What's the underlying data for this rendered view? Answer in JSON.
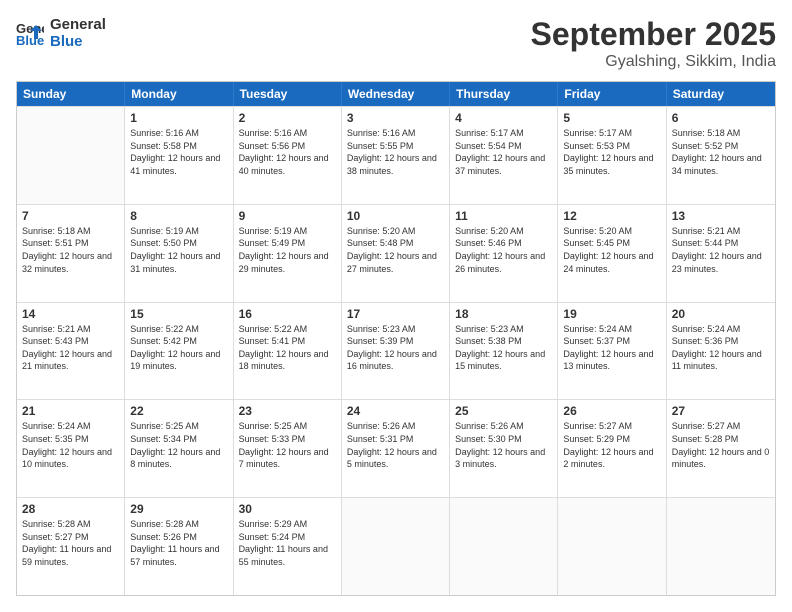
{
  "header": {
    "logo_line1": "General",
    "logo_line2": "Blue",
    "month_title": "September 2025",
    "location": "Gyalshing, Sikkim, India"
  },
  "weekdays": [
    "Sunday",
    "Monday",
    "Tuesday",
    "Wednesday",
    "Thursday",
    "Friday",
    "Saturday"
  ],
  "weeks": [
    [
      {
        "day": "",
        "sunrise": "",
        "sunset": "",
        "daylight": "",
        "empty": true
      },
      {
        "day": "1",
        "sunrise": "Sunrise: 5:16 AM",
        "sunset": "Sunset: 5:58 PM",
        "daylight": "Daylight: 12 hours and 41 minutes."
      },
      {
        "day": "2",
        "sunrise": "Sunrise: 5:16 AM",
        "sunset": "Sunset: 5:56 PM",
        "daylight": "Daylight: 12 hours and 40 minutes."
      },
      {
        "day": "3",
        "sunrise": "Sunrise: 5:16 AM",
        "sunset": "Sunset: 5:55 PM",
        "daylight": "Daylight: 12 hours and 38 minutes."
      },
      {
        "day": "4",
        "sunrise": "Sunrise: 5:17 AM",
        "sunset": "Sunset: 5:54 PM",
        "daylight": "Daylight: 12 hours and 37 minutes."
      },
      {
        "day": "5",
        "sunrise": "Sunrise: 5:17 AM",
        "sunset": "Sunset: 5:53 PM",
        "daylight": "Daylight: 12 hours and 35 minutes."
      },
      {
        "day": "6",
        "sunrise": "Sunrise: 5:18 AM",
        "sunset": "Sunset: 5:52 PM",
        "daylight": "Daylight: 12 hours and 34 minutes."
      }
    ],
    [
      {
        "day": "7",
        "sunrise": "Sunrise: 5:18 AM",
        "sunset": "Sunset: 5:51 PM",
        "daylight": "Daylight: 12 hours and 32 minutes."
      },
      {
        "day": "8",
        "sunrise": "Sunrise: 5:19 AM",
        "sunset": "Sunset: 5:50 PM",
        "daylight": "Daylight: 12 hours and 31 minutes."
      },
      {
        "day": "9",
        "sunrise": "Sunrise: 5:19 AM",
        "sunset": "Sunset: 5:49 PM",
        "daylight": "Daylight: 12 hours and 29 minutes."
      },
      {
        "day": "10",
        "sunrise": "Sunrise: 5:20 AM",
        "sunset": "Sunset: 5:48 PM",
        "daylight": "Daylight: 12 hours and 27 minutes."
      },
      {
        "day": "11",
        "sunrise": "Sunrise: 5:20 AM",
        "sunset": "Sunset: 5:46 PM",
        "daylight": "Daylight: 12 hours and 26 minutes."
      },
      {
        "day": "12",
        "sunrise": "Sunrise: 5:20 AM",
        "sunset": "Sunset: 5:45 PM",
        "daylight": "Daylight: 12 hours and 24 minutes."
      },
      {
        "day": "13",
        "sunrise": "Sunrise: 5:21 AM",
        "sunset": "Sunset: 5:44 PM",
        "daylight": "Daylight: 12 hours and 23 minutes."
      }
    ],
    [
      {
        "day": "14",
        "sunrise": "Sunrise: 5:21 AM",
        "sunset": "Sunset: 5:43 PM",
        "daylight": "Daylight: 12 hours and 21 minutes."
      },
      {
        "day": "15",
        "sunrise": "Sunrise: 5:22 AM",
        "sunset": "Sunset: 5:42 PM",
        "daylight": "Daylight: 12 hours and 19 minutes."
      },
      {
        "day": "16",
        "sunrise": "Sunrise: 5:22 AM",
        "sunset": "Sunset: 5:41 PM",
        "daylight": "Daylight: 12 hours and 18 minutes."
      },
      {
        "day": "17",
        "sunrise": "Sunrise: 5:23 AM",
        "sunset": "Sunset: 5:39 PM",
        "daylight": "Daylight: 12 hours and 16 minutes."
      },
      {
        "day": "18",
        "sunrise": "Sunrise: 5:23 AM",
        "sunset": "Sunset: 5:38 PM",
        "daylight": "Daylight: 12 hours and 15 minutes."
      },
      {
        "day": "19",
        "sunrise": "Sunrise: 5:24 AM",
        "sunset": "Sunset: 5:37 PM",
        "daylight": "Daylight: 12 hours and 13 minutes."
      },
      {
        "day": "20",
        "sunrise": "Sunrise: 5:24 AM",
        "sunset": "Sunset: 5:36 PM",
        "daylight": "Daylight: 12 hours and 11 minutes."
      }
    ],
    [
      {
        "day": "21",
        "sunrise": "Sunrise: 5:24 AM",
        "sunset": "Sunset: 5:35 PM",
        "daylight": "Daylight: 12 hours and 10 minutes."
      },
      {
        "day": "22",
        "sunrise": "Sunrise: 5:25 AM",
        "sunset": "Sunset: 5:34 PM",
        "daylight": "Daylight: 12 hours and 8 minutes."
      },
      {
        "day": "23",
        "sunrise": "Sunrise: 5:25 AM",
        "sunset": "Sunset: 5:33 PM",
        "daylight": "Daylight: 12 hours and 7 minutes."
      },
      {
        "day": "24",
        "sunrise": "Sunrise: 5:26 AM",
        "sunset": "Sunset: 5:31 PM",
        "daylight": "Daylight: 12 hours and 5 minutes."
      },
      {
        "day": "25",
        "sunrise": "Sunrise: 5:26 AM",
        "sunset": "Sunset: 5:30 PM",
        "daylight": "Daylight: 12 hours and 3 minutes."
      },
      {
        "day": "26",
        "sunrise": "Sunrise: 5:27 AM",
        "sunset": "Sunset: 5:29 PM",
        "daylight": "Daylight: 12 hours and 2 minutes."
      },
      {
        "day": "27",
        "sunrise": "Sunrise: 5:27 AM",
        "sunset": "Sunset: 5:28 PM",
        "daylight": "Daylight: 12 hours and 0 minutes."
      }
    ],
    [
      {
        "day": "28",
        "sunrise": "Sunrise: 5:28 AM",
        "sunset": "Sunset: 5:27 PM",
        "daylight": "Daylight: 11 hours and 59 minutes."
      },
      {
        "day": "29",
        "sunrise": "Sunrise: 5:28 AM",
        "sunset": "Sunset: 5:26 PM",
        "daylight": "Daylight: 11 hours and 57 minutes."
      },
      {
        "day": "30",
        "sunrise": "Sunrise: 5:29 AM",
        "sunset": "Sunset: 5:24 PM",
        "daylight": "Daylight: 11 hours and 55 minutes."
      },
      {
        "day": "",
        "sunrise": "",
        "sunset": "",
        "daylight": "",
        "empty": true
      },
      {
        "day": "",
        "sunrise": "",
        "sunset": "",
        "daylight": "",
        "empty": true
      },
      {
        "day": "",
        "sunrise": "",
        "sunset": "",
        "daylight": "",
        "empty": true
      },
      {
        "day": "",
        "sunrise": "",
        "sunset": "",
        "daylight": "",
        "empty": true
      }
    ]
  ]
}
